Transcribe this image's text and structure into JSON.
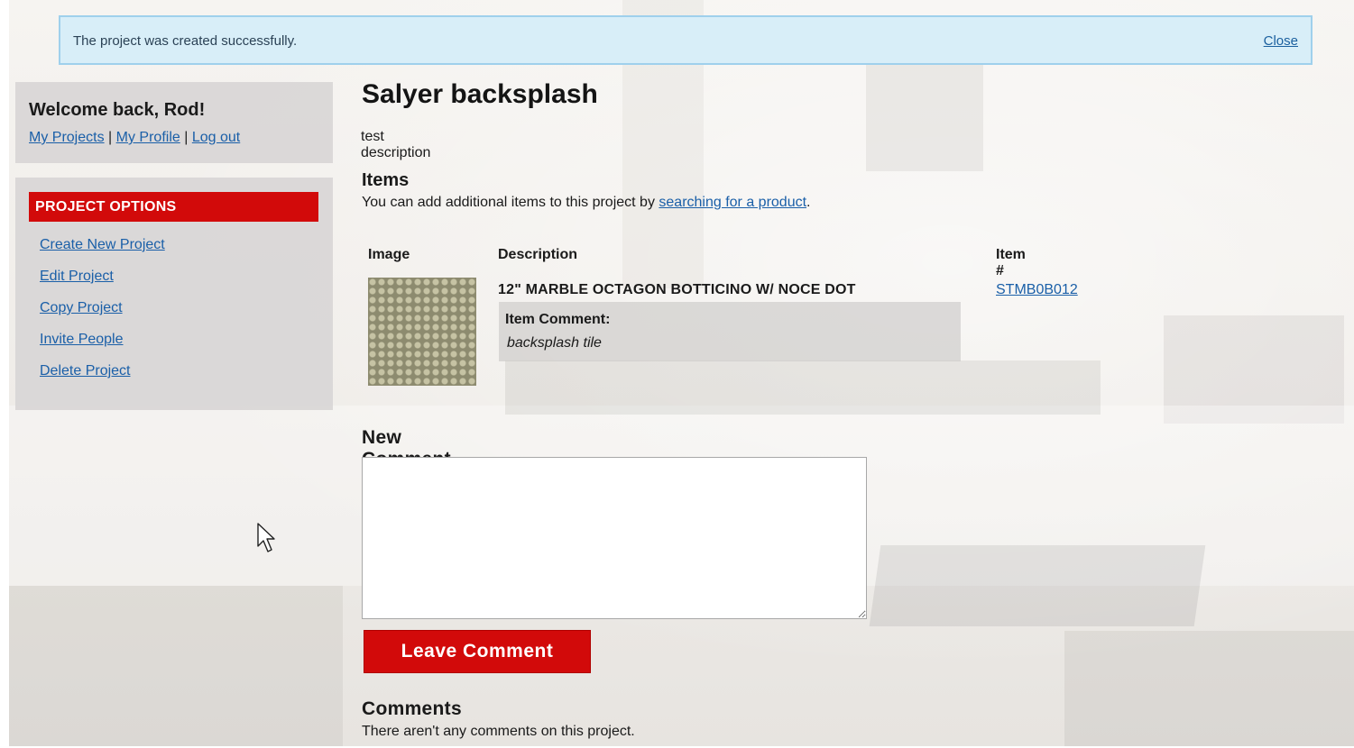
{
  "flash": {
    "message": "The project was created successfully.",
    "close_label": "Close"
  },
  "user_box": {
    "welcome": "Welcome back, Rod!",
    "links": [
      {
        "label": "My Projects"
      },
      {
        "label": "My Profile"
      },
      {
        "label": "Log out"
      }
    ],
    "separator": "|"
  },
  "options": {
    "header": "PROJECT OPTIONS",
    "items": [
      {
        "label": "Create New Project"
      },
      {
        "label": "Edit Project"
      },
      {
        "label": "Copy Project"
      },
      {
        "label": "Invite People"
      },
      {
        "label": "Delete Project"
      }
    ]
  },
  "project": {
    "title": "Salyer backsplash",
    "description": "test description"
  },
  "items": {
    "heading": "Items",
    "intro_before": "You can add additional items to this project by ",
    "intro_link": "searching for a product",
    "intro_after": ".",
    "columns": {
      "image": "Image",
      "description": "Description",
      "item_num": "Item #"
    },
    "rows": [
      {
        "name": "12\" MARBLE OCTAGON BOTTICINO W/ NOCE DOT",
        "comment_label": "Item Comment:",
        "comment": "backsplash tile",
        "item_num": "STMB0B012"
      }
    ]
  },
  "new_comment": {
    "heading": "New Comment",
    "value": "",
    "button_label": "Leave Comment"
  },
  "comments": {
    "heading": "Comments",
    "empty_text": "There aren't any comments on this project."
  },
  "colors": {
    "accent_red": "#d20a0a",
    "link_blue": "#1a5fa8",
    "flash_bg": "#d8eef8",
    "flash_border": "#9fd0ec"
  },
  "icons": {
    "cursor": "mouse-pointer-icon"
  }
}
